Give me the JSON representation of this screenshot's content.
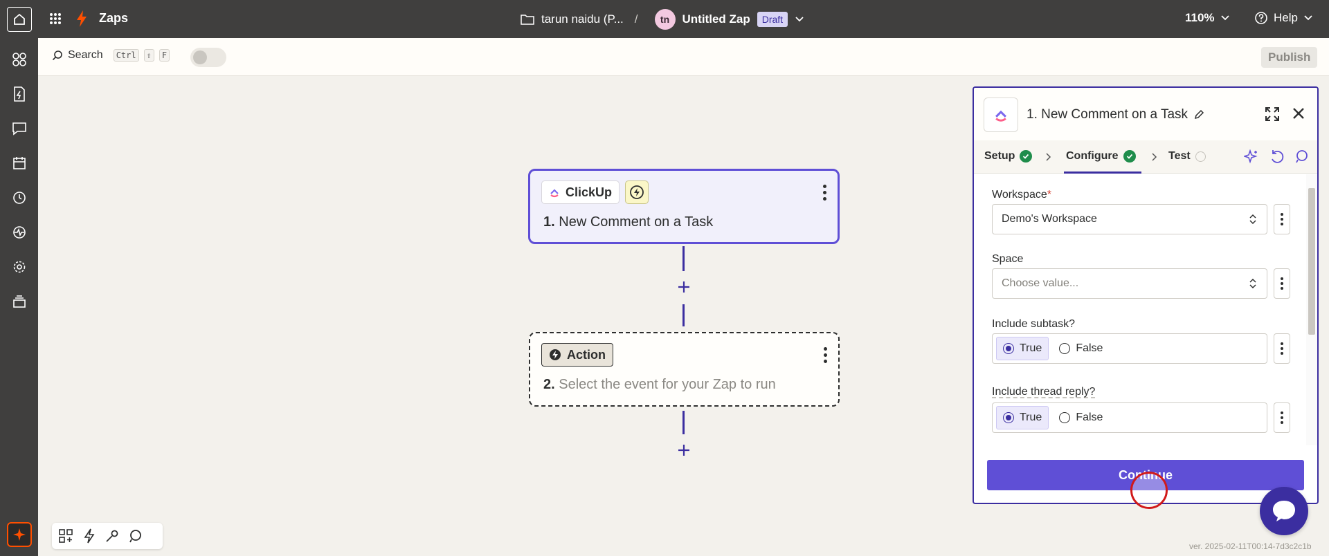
{
  "topbar": {
    "app_label": "Zaps",
    "folder": "tarun naidu (P...",
    "separator": "/",
    "avatar_initials": "tn",
    "zap_title": "Untitled Zap",
    "status_badge": "Draft",
    "zoom": "110%",
    "help_label": "Help"
  },
  "rail": {
    "items": [
      "apps-icon",
      "zap-file-icon",
      "chat-icon",
      "calendar-icon",
      "history-icon",
      "activity-icon",
      "settings-icon",
      "layers-icon"
    ]
  },
  "toolbar": {
    "search_label": "Search",
    "kbd_ctrl": "Ctrl",
    "kbd_shift": "⇧",
    "kbd_f": "F",
    "publish_label": "Publish"
  },
  "canvas": {
    "step1": {
      "app": "ClickUp",
      "number": "1.",
      "title": "New Comment on a Task"
    },
    "step2": {
      "app": "Action",
      "number": "2.",
      "title": "Select the event for your Zap to run"
    }
  },
  "panel": {
    "title": "1. New Comment on a Task",
    "tabs": [
      {
        "label": "Setup",
        "state": "done"
      },
      {
        "label": "Configure",
        "state": "done"
      },
      {
        "label": "Test",
        "state": "pending"
      }
    ],
    "fields": {
      "workspace": {
        "label": "Workspace",
        "required_mark": "*",
        "value": "Demo's Workspace"
      },
      "space": {
        "label": "Space",
        "placeholder": "Choose value..."
      },
      "subtask": {
        "label": "Include subtask?",
        "true_label": "True",
        "false_label": "False",
        "selected": "True"
      },
      "thread": {
        "label": "Include thread reply?",
        "true_label": "True",
        "false_label": "False",
        "selected": "True"
      }
    },
    "continue_label": "Continue"
  },
  "version": "ver. 2025-02-11T00:14-7d3c2c1b",
  "colors": {
    "brand_orange": "#ff4f00",
    "accent_purple": "#5f4fd6",
    "success_green": "#1f8d4b",
    "dark_chrome": "#403f3e"
  }
}
